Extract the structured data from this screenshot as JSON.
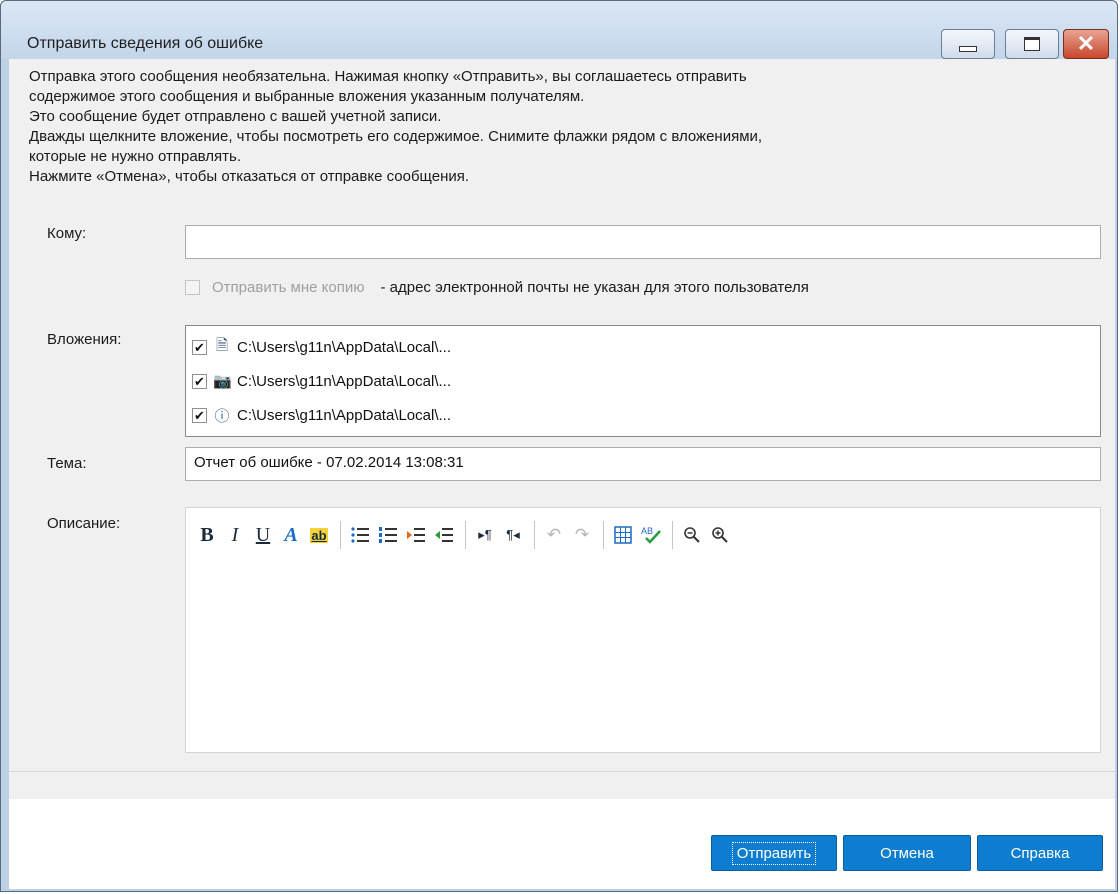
{
  "window": {
    "title": "Отправить сведения об ошибке"
  },
  "intro": [
    "Отправка этого сообщения необязательна.  Нажимая кнопку «Отправить», вы соглашаетесь отправить",
    "содержимое этого сообщения и выбранные вложения указанным получателям.",
    "Это сообщение будет отправлено с вашей учетной записи.",
    "Дважды щелкните вложение, чтобы посмотреть его содержимое. Снимите флажки рядом с вложениями,",
    "которые не нужно отправлять.",
    "Нажмите «Отмена», чтобы отказаться от отправке сообщения."
  ],
  "to": {
    "label": "Кому:",
    "value": ""
  },
  "send_copy": {
    "label": "Отправить мне копию",
    "note": "- адрес электронной почты не указан для этого пользователя",
    "checked": false,
    "disabled": true
  },
  "attachments": {
    "label": "Вложения:",
    "items": [
      {
        "checked": "✔",
        "icon": "document-icon",
        "glyph": "🗎",
        "path": "C:\\Users\\g11n\\AppData\\Local\\..."
      },
      {
        "checked": "✔",
        "icon": "camera-icon",
        "glyph": "📷",
        "path": "C:\\Users\\g11n\\AppData\\Local\\..."
      },
      {
        "checked": "✔",
        "icon": "info-icon",
        "glyph": "ⓘ",
        "path": "C:\\Users\\g11n\\AppData\\Local\\..."
      }
    ]
  },
  "subject": {
    "label": "Тема:",
    "value": "Отчет об ошибке - 07.02.2014 13:08:31"
  },
  "description": {
    "label": "Описание:",
    "value": "",
    "toolbar": {
      "bold": "B",
      "italic": "I",
      "underline": "U",
      "font_color": "A",
      "highlight": "ab"
    }
  },
  "buttons": {
    "send": "Отправить",
    "cancel": "Отмена",
    "help": "Справка"
  },
  "colors": {
    "accent": "#0f7dcf",
    "close_button": "#c9462c"
  }
}
